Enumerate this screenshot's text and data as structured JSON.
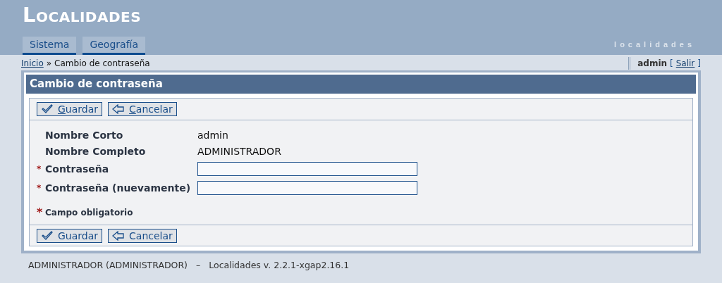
{
  "header": {
    "title": "Localidades",
    "subtitle": "localidades"
  },
  "tabs": [
    {
      "label": "Sistema",
      "selected": false
    },
    {
      "label": "Geografía",
      "selected": false
    }
  ],
  "breadcrumb": {
    "link": "Inicio",
    "separator": "»",
    "current": "Cambio de contraseña"
  },
  "user": {
    "name": "admin",
    "open": "[",
    "logout": "Salir",
    "close": "]"
  },
  "panel": {
    "title": "Cambio de contraseña",
    "toolbars": [
      {
        "mnemonic": true,
        "buttons": [
          {
            "kind": "save",
            "label": "Guardar"
          },
          {
            "kind": "cancel",
            "label": "Cancelar"
          }
        ]
      },
      {
        "mnemonic": false,
        "buttons": [
          {
            "kind": "save",
            "label": "Guardar"
          },
          {
            "kind": "cancel",
            "label": "Cancelar"
          }
        ]
      }
    ],
    "fields": [
      {
        "kind": "text",
        "label": "Nombre Corto",
        "value": "admin",
        "required": false
      },
      {
        "kind": "text",
        "label": "Nombre Completo",
        "value": "ADMINISTRADOR",
        "required": false
      },
      {
        "kind": "input",
        "label": "Contraseña",
        "required": true
      },
      {
        "kind": "input",
        "label": "Contraseña (nuevamente)",
        "required": true
      }
    ],
    "required_note": {
      "mark": "*",
      "text": "Campo obligatorio"
    }
  },
  "footer": {
    "user": "ADMINISTRADOR (ADMINISTRADOR)",
    "separator": "–",
    "version": "Localidades v. 2.2.1-xgap2.16.1"
  }
}
